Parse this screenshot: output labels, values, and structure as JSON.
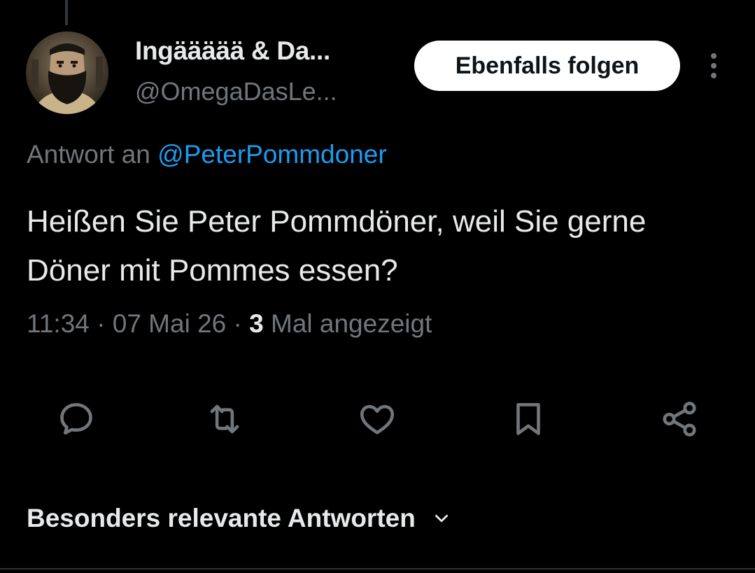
{
  "author": {
    "display_name": "Ingäääää & Da...",
    "handle": "@OmegaDasLe..."
  },
  "follow_button": {
    "label": "Ebenfalls folgen"
  },
  "reply_context": {
    "prefix": "Antwort an ",
    "mention": "@PeterPommdoner"
  },
  "tweet": {
    "text": "Heißen Sie Peter Pommdöner, weil Sie gerne Döner mit Pommes essen?",
    "time": "11:34",
    "date": "07 Mai 26",
    "separator": " · ",
    "views_count": "3",
    "views_label": " Mal angezeigt"
  },
  "actions": [
    {
      "name": "reply",
      "icon": "speech-bubble-icon"
    },
    {
      "name": "repost",
      "icon": "repost-arrows-icon"
    },
    {
      "name": "like",
      "icon": "heart-icon"
    },
    {
      "name": "bookmark",
      "icon": "bookmark-icon"
    },
    {
      "name": "share",
      "icon": "share-nodes-icon"
    }
  ],
  "replies_sort": {
    "label": "Besonders relevante Antworten",
    "icon": "chevron-down-icon"
  },
  "colors": {
    "background": "#000000",
    "primary_text": "#e7e9ea",
    "secondary_text": "#71767b",
    "link": "#1d9bf0",
    "button_bg": "#ffffff"
  }
}
